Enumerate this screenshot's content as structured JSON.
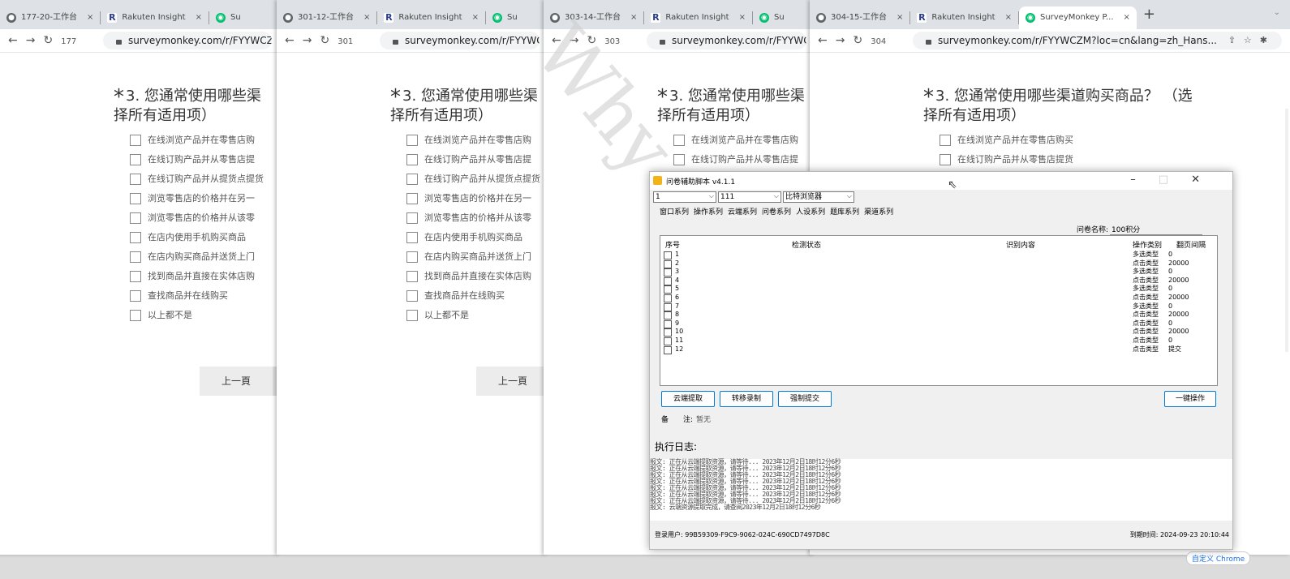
{
  "windows": [
    {
      "tabs": [
        {
          "favicon": "c",
          "title": "177-20-工作台",
          "close": "×"
        },
        {
          "favicon": "r",
          "title": "Rakuten Insight",
          "close": "×"
        },
        {
          "favicon": "s",
          "title": "Su",
          "close": ""
        }
      ],
      "profile": "177",
      "url": "surveymonkey.com/r/FYYWCZM",
      "question_line1": "3. 您通常使用哪些渠",
      "question_line2": "择所有适用项）",
      "options": [
        "在线浏览产品并在零售店购",
        "在线订购产品并从零售店提",
        "在线订购产品并从提货点提货",
        "浏览零售店的价格并在另一",
        "浏览零售店的价格并从该零",
        "在店内使用手机购买商品",
        "在店内购买商品并送货上门",
        "找到商品并直接在实体店购",
        "查找商品并在线购买",
        "以上都不是"
      ],
      "prev": "上一頁"
    },
    {
      "tabs": [
        {
          "favicon": "c",
          "title": "301-12-工作台",
          "close": "×"
        },
        {
          "favicon": "r",
          "title": "Rakuten Insight",
          "close": "×"
        },
        {
          "favicon": "s",
          "title": "Su",
          "close": ""
        }
      ],
      "profile": "301",
      "url": "surveymonkey.com/r/FYYWCZM",
      "question_line1": "3. 您通常使用哪些渠",
      "question_line2": "择所有适用项）",
      "options": [
        "在线浏览产品并在零售店购",
        "在线订购产品并从零售店提",
        "在线订购产品并从提货点提货",
        "浏览零售店的价格并在另一",
        "浏览零售店的价格并从该零",
        "在店内使用手机购买商品",
        "在店内购买商品并送货上门",
        "找到商品并直接在实体店购",
        "查找商品并在线购买",
        "以上都不是"
      ],
      "prev": "上一頁"
    },
    {
      "tabs": [
        {
          "favicon": "c",
          "title": "303-14-工作台",
          "close": "×"
        },
        {
          "favicon": "r",
          "title": "Rakuten Insight",
          "close": "×"
        },
        {
          "favicon": "s",
          "title": "Su",
          "close": ""
        }
      ],
      "profile": "303",
      "url": "surveymonkey.com/r/FYYWCZM",
      "question_line1": "3. 您通常使用哪些渠",
      "question_line2": "择所有适用项）",
      "options": [
        "在线浏览产品并在零售店购",
        "在线订购产品并从零售店提"
      ]
    },
    {
      "tabs": [
        {
          "favicon": "c",
          "title": "304-15-工作台",
          "close": "×"
        },
        {
          "favicon": "r",
          "title": "Rakuten Insight",
          "close": "×"
        },
        {
          "favicon": "s",
          "title": "SurveyMonkey P...",
          "close": "×"
        }
      ],
      "profile": "304",
      "url": "surveymonkey.com/r/FYYWCZM?loc=cn&lang=zh_Hans...",
      "question_line1": "3. 您通常使用哪些渠道购买商品？ （选",
      "question_line2": "择所有适用项）",
      "options": [
        "在线浏览产品并在零售店购买",
        "在线订购产品并从零售店提货"
      ]
    }
  ],
  "watermark": "Why",
  "tool": {
    "title": "问卷辅助脚本 v4.1.1",
    "sel1": "1",
    "sel2": "111",
    "sel3": "比特浏览器",
    "menus": [
      "窗口系列",
      "操作系列",
      "云端系列",
      "问卷系列",
      "人设系列",
      "题库系列",
      "渠道系列"
    ],
    "qname_label": "问卷名称:",
    "qname_value": "100积分",
    "headers": {
      "seq": "序号",
      "status": "检测状态",
      "content": "识别内容",
      "op": "操作类别",
      "flip": "翻页间隔"
    },
    "rows": [
      {
        "n": "1",
        "op": "多选类型",
        "flip": "0"
      },
      {
        "n": "2",
        "op": "点击类型",
        "flip": "20000"
      },
      {
        "n": "3",
        "op": "多选类型",
        "flip": "0"
      },
      {
        "n": "4",
        "op": "点击类型",
        "flip": "20000"
      },
      {
        "n": "5",
        "op": "多选类型",
        "flip": "0"
      },
      {
        "n": "6",
        "op": "点击类型",
        "flip": "20000"
      },
      {
        "n": "7",
        "op": "多选类型",
        "flip": "0"
      },
      {
        "n": "8",
        "op": "点击类型",
        "flip": "20000"
      },
      {
        "n": "9",
        "op": "点击类型",
        "flip": "0"
      },
      {
        "n": "10",
        "op": "点击类型",
        "flip": "20000"
      },
      {
        "n": "11",
        "op": "点击类型",
        "flip": "0"
      },
      {
        "n": "12",
        "op": "点击类型",
        "flip": "提交"
      }
    ],
    "btn_cloud": "云端提取",
    "btn_transfer": "转移录制",
    "btn_force": "强制提交",
    "btn_one": "一键操作",
    "note_label": "备　　注:",
    "note_value": "暂无",
    "log_title": "执行日志:",
    "log_lines": [
      "报文: 正在从云端提取资源，请等待...  2023年12月2日18时12分6秒",
      "报文: 正在从云端提取资源，请等待...  2023年12月2日18时12分6秒",
      "报文: 正在从云端提取资源，请等待...  2023年12月2日18时12分6秒",
      "报文: 正在从云端提取资源，请等待...  2023年12月2日18时12分6秒",
      "报文: 正在从云端提取资源，请等待...  2023年12月2日18时12分6秒",
      "报文: 正在从云端提取资源，请等待...  2023年12月2日18时12分6秒",
      "报文: 正在从云端提取资源，请等待...  2023年12月2日18时12分6秒",
      "报文: 云端资源提取完成，请查阅2023年12月2日18时12分6秒"
    ],
    "login_label": "登录用户:",
    "login_value": "99B59309-F9C9-9062-024C-690CD7497D8C",
    "expire_label": "到期时间:",
    "expire_value": "2024-09-23 20:10:44"
  },
  "chrome_customize": "自定义 Chrome"
}
